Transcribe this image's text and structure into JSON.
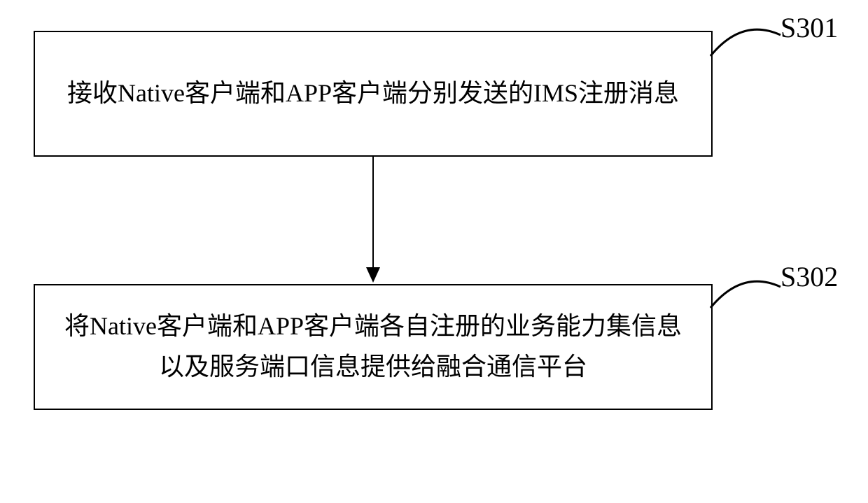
{
  "flowchart": {
    "steps": [
      {
        "id": "S301",
        "text": "接收Native客户端和APP客户端分别发送的IMS注册消息"
      },
      {
        "id": "S302",
        "text": "将Native客户端和APP客户端各自注册的业务能力集信息以及服务端口信息提供给融合通信平台"
      }
    ]
  }
}
